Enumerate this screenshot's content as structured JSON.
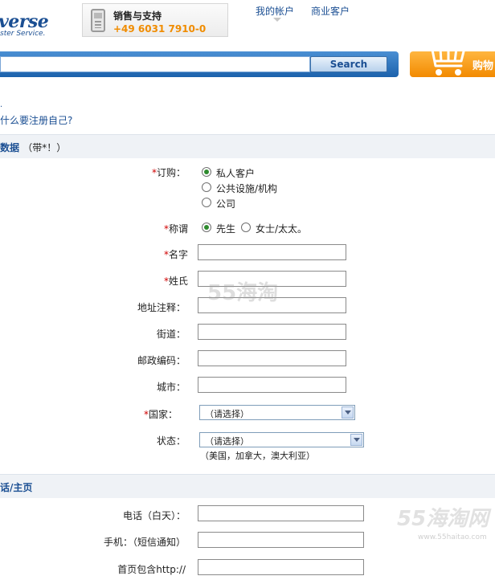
{
  "header": {
    "logo_text": "verse",
    "logo_tagline": "ster Service.",
    "support_title": "销售与支持",
    "support_phone": "+49 6031 7910-0",
    "links": {
      "my_account": "我的帐户",
      "business": "商业客户"
    },
    "search_placeholder": "",
    "search_button": "Search",
    "cart_label": "购物"
  },
  "intro": {
    "dot": "·",
    "why_register": "什么要注册自己?"
  },
  "section_personal": {
    "title": "数据",
    "note": "（带*！）"
  },
  "form": {
    "order": {
      "label": "订购：",
      "options": [
        "私人客户",
        "公共设施/机构",
        "公司"
      ],
      "selected_index": 0
    },
    "salutation": {
      "label": "称谓",
      "options": [
        "先生",
        "女士/太太。"
      ],
      "selected_index": 0
    },
    "first_name": {
      "label": "名字",
      "value": ""
    },
    "last_name": {
      "label": "姓氏",
      "value": ""
    },
    "address_note": {
      "label": "地址注释：",
      "value": ""
    },
    "street": {
      "label": "街道：",
      "value": ""
    },
    "postcode": {
      "label": "邮政编码：",
      "value": ""
    },
    "city": {
      "label": "城市：",
      "value": ""
    },
    "country": {
      "label": "国家：",
      "selected": "（请选择）"
    },
    "state": {
      "label": "状态：",
      "selected": "（请选择）",
      "hint": "（美国，加拿大，澳大利亚）"
    }
  },
  "section_contact": {
    "title": "话/主页"
  },
  "contact": {
    "phone_day": {
      "label": "电话（白天）：",
      "value": ""
    },
    "mobile": {
      "label": "手机：（短信通知）",
      "value": ""
    },
    "homepage": {
      "label": "首页包含http://",
      "value": ""
    }
  },
  "watermarks": {
    "main": "55海淘",
    "corner": "55海淘网",
    "corner_url": "www.55haitao.com"
  },
  "colors": {
    "link": "#1b4f93",
    "required": "#d00000",
    "phone": "#f08c00",
    "search_bar": "#1c62ac",
    "cart": "#f28a00"
  },
  "icons": {
    "support": "phone-icon",
    "cart": "shopping-cart-icon"
  }
}
